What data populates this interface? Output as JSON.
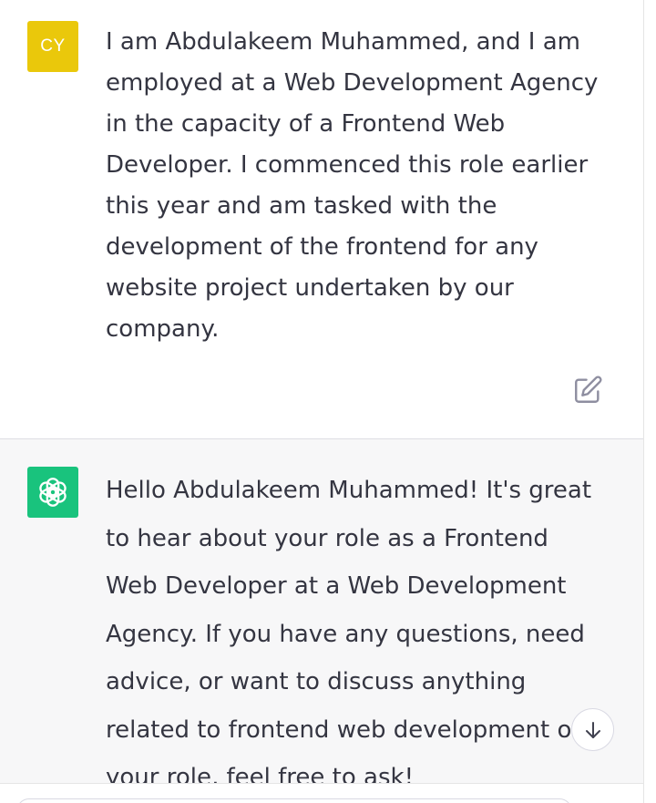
{
  "user_message": {
    "avatar_initials": "CY",
    "avatar_color": "#eac80b",
    "text": "I am Abdulakeem Muhammed, and I am employed at a Web Development Agency in the capacity of a Frontend Web Developer. I commenced this role earlier this year and am tasked with the development of the frontend for any website project undertaken by our company.",
    "edit_icon": "edit-icon"
  },
  "assistant_message": {
    "avatar_icon": "openai-logo-icon",
    "avatar_color": "#19c37d",
    "text": "Hello Abdulakeem Muhammed! It's great to hear about your role as a Frontend Web Developer at a Web Development Agency. If you have any questions, need advice, or want to discuss anything related to frontend web development or your role, feel free to ask!"
  },
  "scroll_button": {
    "icon": "arrow-down-icon"
  },
  "colors": {
    "text": "#343541",
    "assistant_background": "#f7f7f8",
    "border": "#d9d9e3"
  }
}
